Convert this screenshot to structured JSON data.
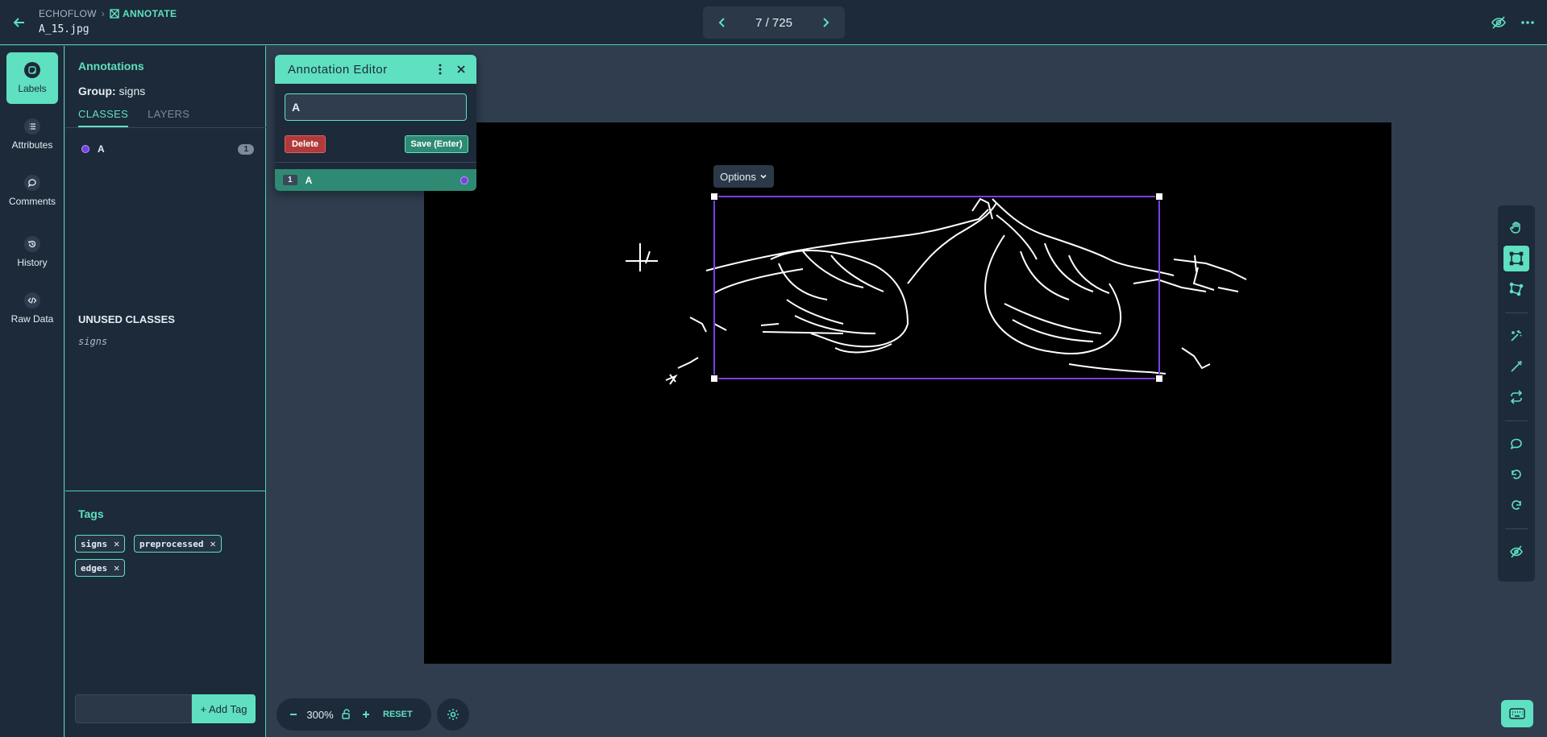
{
  "header": {
    "breadcrumb_root": "ECHOFLOW",
    "breadcrumb_current": "ANNOTATE",
    "filename": "A_15.jpg",
    "page_indicator": "7 / 725"
  },
  "rail": {
    "items": [
      {
        "label": "Labels",
        "icon": "labels-icon"
      },
      {
        "label": "Attributes",
        "icon": "list-icon"
      },
      {
        "label": "Comments",
        "icon": "comment-icon"
      },
      {
        "label": "History",
        "icon": "history-icon"
      },
      {
        "label": "Raw Data",
        "icon": "code-icon"
      }
    ]
  },
  "panel": {
    "title": "Annotations",
    "group_label": "Group:",
    "group_value": "signs",
    "tabs": [
      "CLASSES",
      "LAYERS"
    ],
    "classes": [
      {
        "name": "A",
        "count": "1",
        "color": "#7b3fe4"
      }
    ],
    "unused_title": "UNUSED CLASSES",
    "unused": [
      "signs"
    ],
    "tags_title": "Tags",
    "tags": [
      "signs",
      "preprocessed",
      "edges"
    ],
    "add_tag_label": "+ Add Tag",
    "tag_input_placeholder": ""
  },
  "editor": {
    "title": "Annotation Editor",
    "input_value": "A",
    "delete_label": "Delete",
    "save_label": "Save (Enter)",
    "row_number": "1",
    "row_label": "A"
  },
  "canvas": {
    "options_label": "Options"
  },
  "zoom": {
    "value": "300%",
    "reset_label": "RESET"
  },
  "toolbar": {
    "tools": [
      "pan-icon",
      "bounding-box-icon",
      "polygon-icon",
      "magic-wand-icon",
      "smart-wand-icon",
      "repeat-icon",
      "comment-icon",
      "undo-icon",
      "redo-icon",
      "hide-icon"
    ]
  },
  "colors": {
    "accent": "#5fe0c0",
    "panel_bg": "#1c2a3a",
    "workspace_bg": "#2f3d4f",
    "bbox": "#7b3fe4",
    "delete": "#b03a3a"
  }
}
